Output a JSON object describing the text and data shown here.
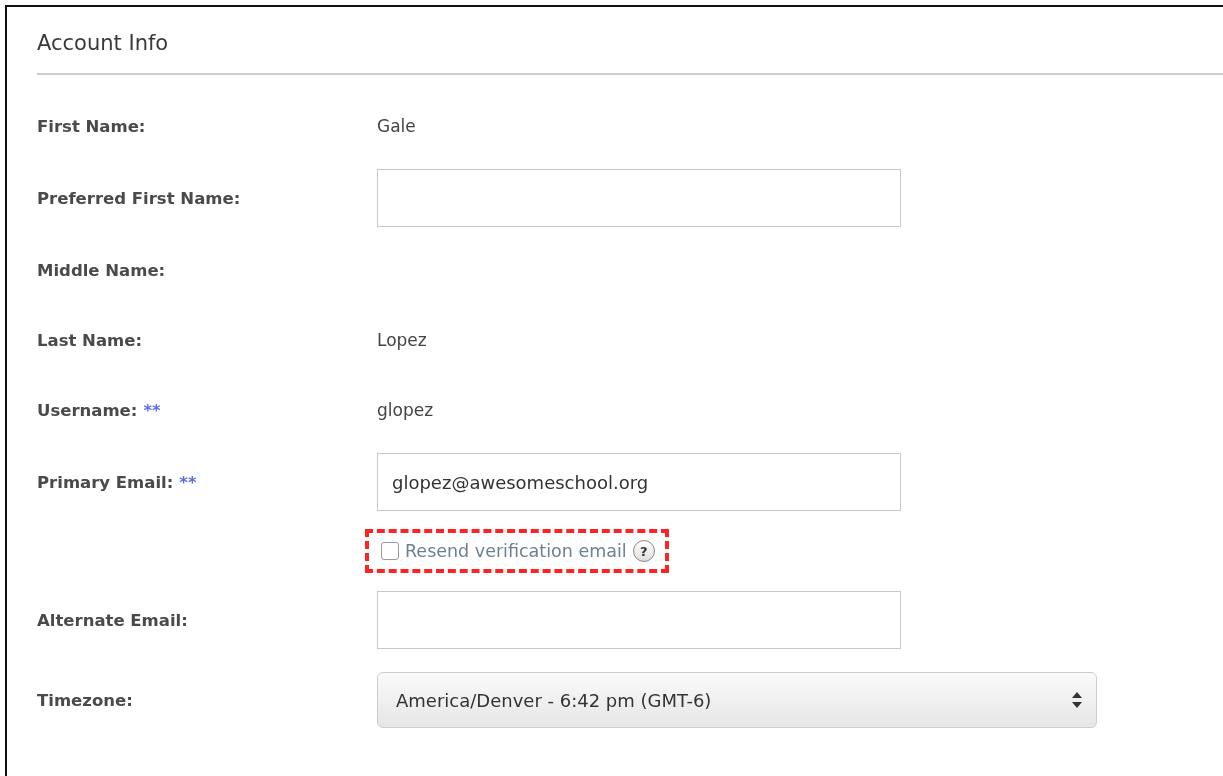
{
  "section": {
    "title": "Account Info"
  },
  "fields": [
    {
      "kind": "text",
      "label": "First Name:",
      "value": "Gale"
    },
    {
      "kind": "input",
      "label": "Preferred First Name:"
    },
    {
      "kind": "text",
      "label": "Middle Name:"
    },
    {
      "kind": "text",
      "label": "Last Name:",
      "value": "Lopez"
    },
    {
      "kind": "text",
      "label": "Username:",
      "required_mark": "**",
      "value": "glopez"
    },
    {
      "kind": "input",
      "label": "Primary Email:",
      "required_mark": "**",
      "value": "glopez@awesomeschool.org"
    },
    {
      "kind": "checkbox",
      "label": "Resend verification email",
      "checked": false,
      "help": "?",
      "highlighted": true
    },
    {
      "kind": "input",
      "label": "Alternate Email:"
    },
    {
      "kind": "select",
      "label": "Timezone:",
      "value": "America/Denver - 6:42 pm (GMT-6)"
    }
  ]
}
